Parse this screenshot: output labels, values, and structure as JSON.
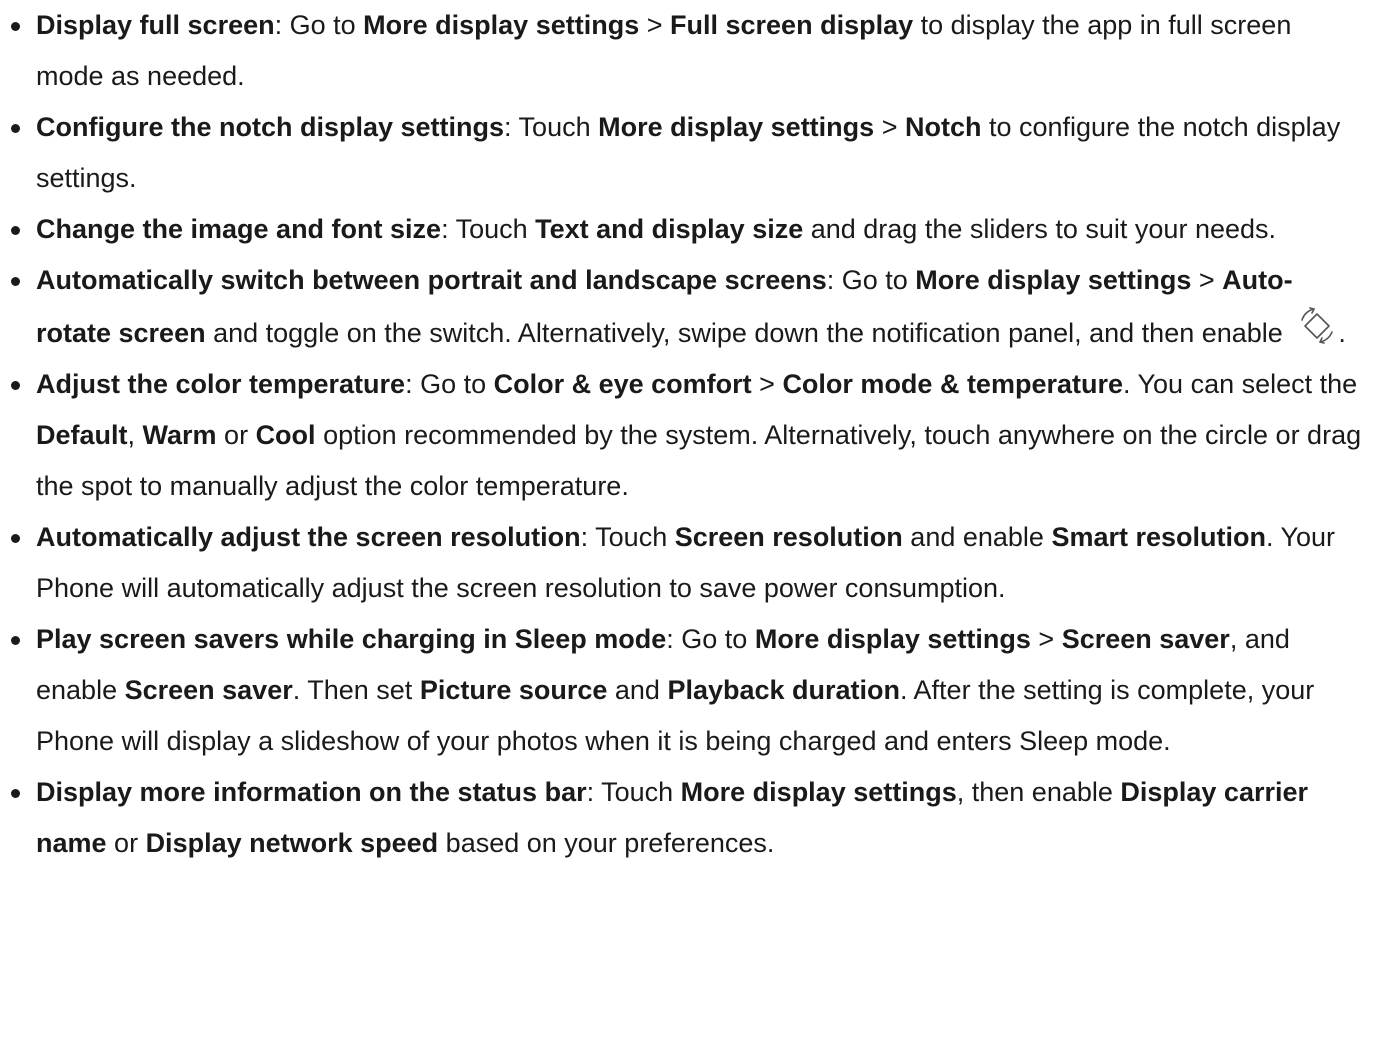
{
  "items": [
    {
      "title": "Display full screen",
      "parts": [
        ": Go to ",
        "More display settings",
        " > ",
        "Full screen display",
        " to display the app in full screen mode as needed."
      ]
    },
    {
      "title": "Configure the notch display settings",
      "parts": [
        ": Touch ",
        "More display settings",
        " > ",
        "Notch",
        " to configure the notch display settings."
      ]
    },
    {
      "title": "Change the image and font size",
      "parts": [
        ": Touch ",
        "Text and display size",
        " and drag the sliders to suit your needs."
      ]
    },
    {
      "title": "Automatically switch between portrait and landscape screens",
      "parts": [
        ": Go to ",
        "More display settings",
        " > ",
        "Auto-rotate screen",
        " and toggle on the switch. Alternatively, swipe down the notification panel, and then enable ",
        "."
      ],
      "icon": "auto-rotate-icon"
    },
    {
      "title": "Adjust the color temperature",
      "parts": [
        ": Go to ",
        "Color & eye comfort",
        " > ",
        "Color mode & temperature",
        ". You can select the ",
        "Default",
        ", ",
        "Warm",
        " or ",
        "Cool",
        " option recommended by the system. Alternatively, touch anywhere on the circle or drag the spot to manually adjust the color temperature."
      ]
    },
    {
      "title": "Automatically adjust the screen resolution",
      "parts": [
        ": Touch ",
        "Screen resolution",
        " and enable ",
        "Smart resolution",
        ". Your Phone will automatically adjust the screen resolution to save power consumption."
      ]
    },
    {
      "title": "Play screen savers while charging in Sleep mode",
      "parts": [
        ": Go to ",
        "More display settings",
        " > ",
        "Screen saver",
        ", and enable ",
        "Screen saver",
        ". Then set ",
        "Picture source",
        " and ",
        "Playback duration",
        ". After the setting is complete, your Phone will display a slideshow of your photos when it is being charged and enters Sleep mode."
      ]
    },
    {
      "title": "Display more information on the status bar",
      "parts": [
        ": Touch ",
        "More display settings",
        ", then enable ",
        "Display carrier name",
        " or ",
        "Display network speed",
        " based on your preferences."
      ]
    }
  ]
}
